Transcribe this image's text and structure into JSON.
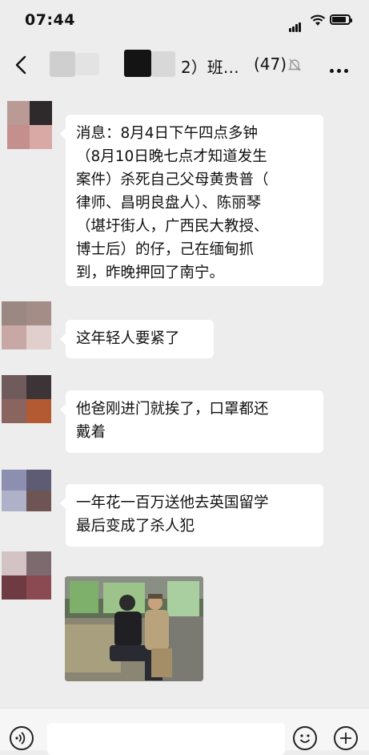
{
  "status_bar": {
    "time": "07:44",
    "battery_level": 0.85
  },
  "nav": {
    "title": "2）班…",
    "member_count": "(47)",
    "back_icon": "chevron-left-icon",
    "mute_icon": "bell-muted-icon",
    "more_icon": "more-dots-icon"
  },
  "messages": [
    {
      "type": "text",
      "text": "消息：8月4日下午四点多钟\n（8月10日晚七点才知道发生\n案件）杀死自己父母黄贵普（\n律师、昌明良盘人）、陈丽琴\n（堪圩街人，广西民大教授、\n博士后）的仔，己在缅甸抓\n到，昨晚押回了南宁。"
    },
    {
      "type": "text",
      "text": "这年轻人要紧了"
    },
    {
      "type": "text",
      "text": "他爸刚进门就挨了，口罩都还\n戴着"
    },
    {
      "type": "text",
      "text": "一年花一百万送他去英国留学\n最后变成了杀人犯"
    },
    {
      "type": "image",
      "description_icon": "photo-thumbnail"
    }
  ],
  "input_bar": {
    "voice_icon": "voice-icon",
    "emoji_icon": "emoji-icon",
    "plus_icon": "plus-icon"
  },
  "colors": {
    "background": "#ededed",
    "bubble": "#ffffff",
    "text": "#111111"
  }
}
